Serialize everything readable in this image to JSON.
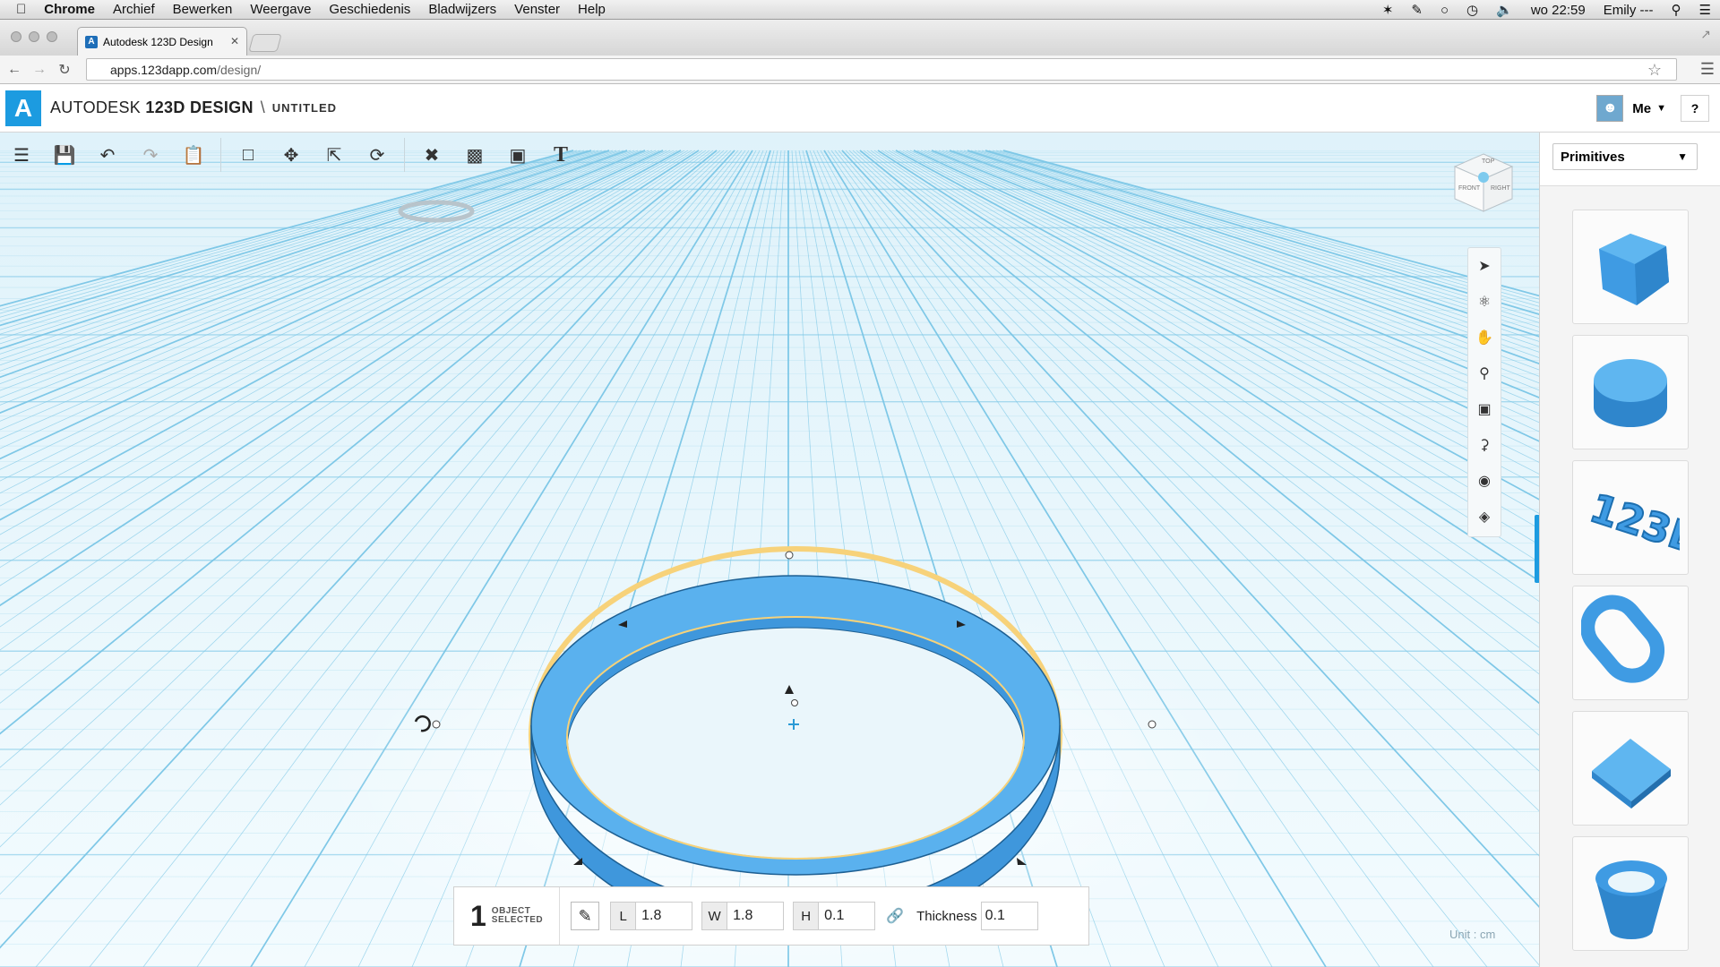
{
  "menubar": {
    "items": [
      "Chrome",
      "Archief",
      "Bewerken",
      "Weergave",
      "Geschiedenis",
      "Bladwijzers",
      "Venster",
      "Help"
    ],
    "clock": "wo 22:59",
    "user": "Emily ---"
  },
  "browser": {
    "tab_title": "Autodesk 123D Design",
    "url_host": "apps.123dapp.com",
    "url_path": "/design/"
  },
  "app": {
    "brand_autodesk": "AUTODESK",
    "brand_product": "123D",
    "brand_design": "DESIGN",
    "separator": "\\",
    "document_title": "UNTITLED",
    "user_label": "Me",
    "help_label": "?"
  },
  "toolbar": {
    "icons": [
      "menu-icon",
      "save-icon",
      "undo-icon",
      "redo-icon",
      "clipboard-icon",
      "primitives-box-icon",
      "move-icon",
      "scale-icon",
      "refresh-icon",
      "construct-icon",
      "group-icon",
      "combine-icon",
      "text-tool-icon"
    ]
  },
  "viewcube": {
    "top": "TOP",
    "front": "FRONT",
    "right": "RIGHT"
  },
  "panel": {
    "dropdown_label": "Primitives",
    "tiles": [
      "box",
      "cylinder",
      "text-123d",
      "torus",
      "wedge",
      "cone"
    ]
  },
  "selection": {
    "count": "1",
    "label_line1": "OBJECT",
    "label_line2": "SELECTED",
    "L_label": "L",
    "L_value": "1.8",
    "W_label": "W",
    "W_value": "1.8",
    "H_label": "H",
    "H_value": "0.1",
    "thickness_label": "Thickness",
    "thickness_value": "0.1"
  },
  "unit_label": "Unit : cm",
  "colors": {
    "accent": "#1c9be0",
    "ring": "#4aa6e6",
    "grid": "#7cc7e6",
    "viewport_bg": "#e9f6fb"
  }
}
